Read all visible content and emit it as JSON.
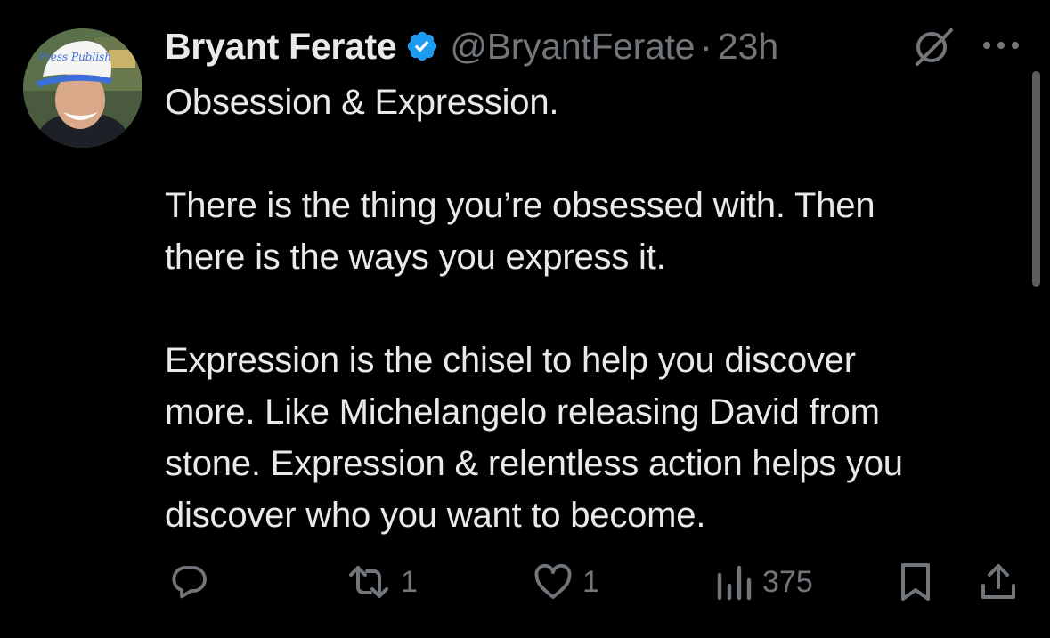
{
  "tweet": {
    "author_name": "Bryant Ferate",
    "handle": "@BryantFerate",
    "separator": "·",
    "time": "23h",
    "verified": true,
    "paragraphs": [
      "Obsession & Expression.",
      "There is the thing you’re obsessed with. Then\nthere is the ways you express it.",
      "Expression is the chisel to help you discover\nmore. Like Michelangelo releasing David from\nstone. Expression & relentless action helps you\ndiscover who you want to become."
    ]
  },
  "avatar": {
    "hat_text": "Press Publish"
  },
  "actions": {
    "replies": "",
    "reposts": "1",
    "likes": "1",
    "views": "375"
  },
  "icons": {
    "verified": "verified-badge-icon",
    "grok": "grok-icon",
    "more": "more-icon",
    "reply": "reply-icon",
    "repost": "repost-icon",
    "like": "like-icon",
    "views": "views-icon",
    "bookmark": "bookmark-icon",
    "share": "share-icon"
  },
  "colors": {
    "background": "#000000",
    "text_primary": "#e7e9ea",
    "text_secondary": "#71767b",
    "verified_blue": "#1d9bf0"
  }
}
